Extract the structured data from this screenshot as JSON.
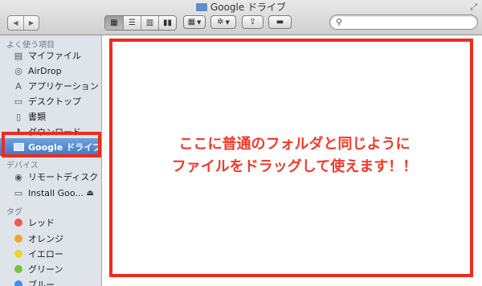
{
  "window": {
    "title": "Google ドライブ",
    "fullscreen_icon": "fullscreen-arrows-icon"
  },
  "toolbar": {
    "back_icon": "◀",
    "forward_icon": "▶",
    "view_icons": [
      "icon-view",
      "list-view",
      "column-view",
      "coverflow-view"
    ],
    "arrange_icon": "arrange-grid-icon",
    "action_icon": "gear-icon",
    "share_icon": "share-icon",
    "tag_icon": "tag-toggle-icon",
    "search": {
      "placeholder": "",
      "value": ""
    }
  },
  "sidebar": {
    "favorites_header": "よく使う項目",
    "favorites": [
      {
        "label": "マイファイル",
        "icon": "all-my-files-icon"
      },
      {
        "label": "AirDrop",
        "icon": "airdrop-icon"
      },
      {
        "label": "アプリケーション",
        "icon": "applications-icon"
      },
      {
        "label": "デスクトップ",
        "icon": "desktop-icon"
      },
      {
        "label": "書類",
        "icon": "documents-icon"
      },
      {
        "label": "ダウンロード",
        "icon": "downloads-icon"
      },
      {
        "label": "Google ドライブ",
        "icon": "folder-icon",
        "selected": true
      }
    ],
    "devices_header": "デバイス",
    "devices": [
      {
        "label": "リモートディスク",
        "icon": "remote-disc-icon"
      },
      {
        "label": "Install Goo...",
        "icon": "disk-icon",
        "eject": "⏏"
      }
    ],
    "tags_header": "タグ",
    "tags": [
      {
        "label": "レッド",
        "color": "#f0584f"
      },
      {
        "label": "オレンジ",
        "color": "#f7a033"
      },
      {
        "label": "イエロー",
        "color": "#ecd52e"
      },
      {
        "label": "グリーン",
        "color": "#74c53b"
      },
      {
        "label": "ブルー",
        "color": "#3e8ef0"
      }
    ]
  },
  "main": {
    "instruction_line1": "ここに普通のフォルダと同じように",
    "instruction_line2": "ファイルをドラッグして使えます！！",
    "highlight_color": "#ee2b1c"
  }
}
